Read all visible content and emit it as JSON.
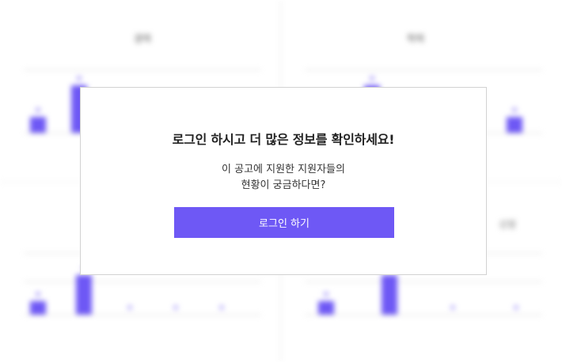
{
  "modal": {
    "title": "로그인 하시고 더 많은 정보를 확인하세요!",
    "description_line1": "이 공고에 지원한 지원자들의",
    "description_line2": "현황이 궁금하다면?",
    "login_button": "로그인 하기"
  },
  "colors": {
    "accent": "#6e58f5",
    "overlay_border": "#d2d2d2"
  },
  "chart_data": [
    {
      "type": "bar",
      "title": "",
      "categories": [
        "",
        "",
        "",
        "",
        ""
      ],
      "values": [
        1,
        3,
        0,
        0,
        0
      ],
      "ylim": [
        0,
        3
      ]
    },
    {
      "type": "bar",
      "title": "",
      "categories": [
        "",
        "",
        "",
        "",
        ""
      ],
      "values": [
        0,
        3,
        0,
        0,
        1
      ],
      "ylim": [
        0,
        3
      ]
    },
    {
      "type": "bar",
      "categories": [
        "",
        "",
        "",
        "",
        ""
      ],
      "values": [
        1,
        3,
        0,
        0,
        0
      ],
      "ylim": [
        0,
        3
      ]
    },
    {
      "type": "bar",
      "categories": [
        "",
        "",
        "",
        ""
      ],
      "values": [
        1,
        3,
        0,
        0
      ],
      "ylim": [
        0,
        3
      ]
    }
  ]
}
